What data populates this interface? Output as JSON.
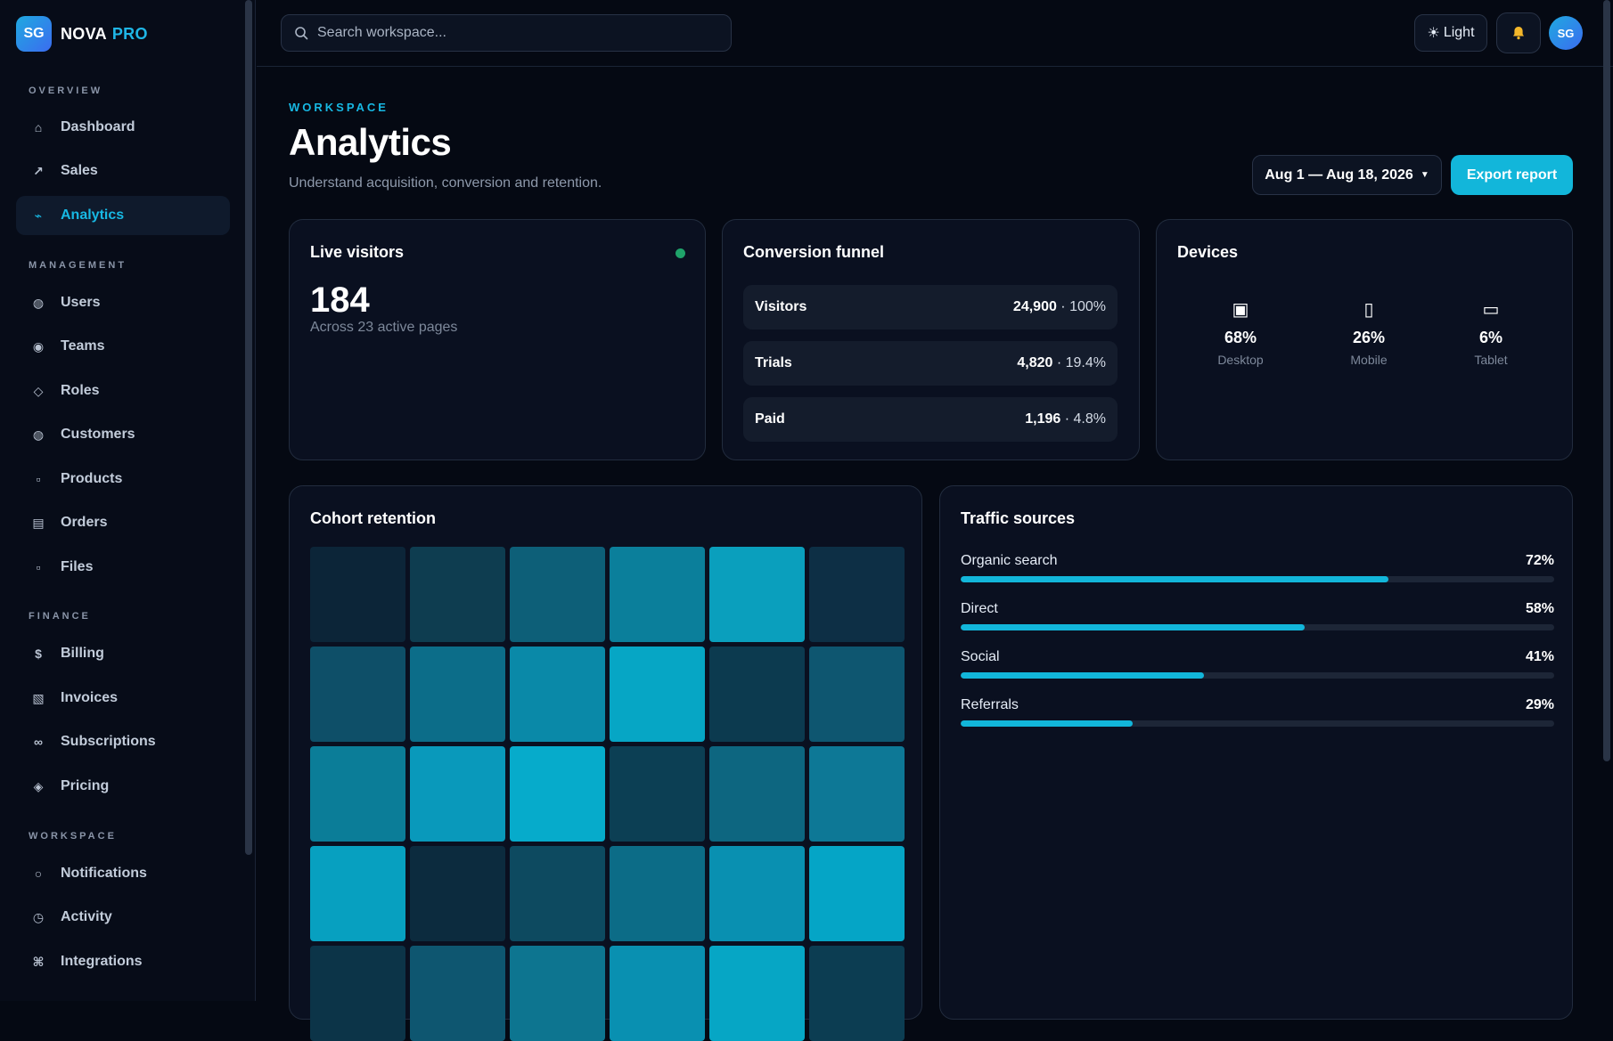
{
  "app": {
    "logo_initials": "SG",
    "name": "NOVA",
    "suffix": "PRO"
  },
  "sidebar": {
    "sections": [
      {
        "label": "OVERVIEW",
        "items": [
          {
            "label": "Dashboard",
            "icon": "home-icon",
            "glyph": "⌂"
          },
          {
            "label": "Sales",
            "icon": "trend-up-icon",
            "glyph": "↗"
          },
          {
            "label": "Analytics",
            "icon": "activity-icon",
            "glyph": "⌁",
            "active": true
          }
        ]
      },
      {
        "label": "MANAGEMENT",
        "items": [
          {
            "label": "Users",
            "icon": "users-icon",
            "glyph": "◍"
          },
          {
            "label": "Teams",
            "icon": "teams-icon",
            "glyph": "◉"
          },
          {
            "label": "Roles",
            "icon": "roles-icon",
            "glyph": "◇"
          },
          {
            "label": "Customers",
            "icon": "customers-icon",
            "glyph": "◍"
          },
          {
            "label": "Products",
            "icon": "products-icon",
            "glyph": "▫"
          },
          {
            "label": "Orders",
            "icon": "orders-icon",
            "glyph": "▤"
          },
          {
            "label": "Files",
            "icon": "files-icon",
            "glyph": "▫"
          }
        ]
      },
      {
        "label": "FINANCE",
        "items": [
          {
            "label": "Billing",
            "icon": "dollar-icon",
            "glyph": "$"
          },
          {
            "label": "Invoices",
            "icon": "invoice-icon",
            "glyph": "▧"
          },
          {
            "label": "Subscriptions",
            "icon": "infinity-icon",
            "glyph": "∞"
          },
          {
            "label": "Pricing",
            "icon": "tag-icon",
            "glyph": "◈"
          }
        ]
      },
      {
        "label": "WORKSPACE",
        "items": [
          {
            "label": "Notifications",
            "icon": "bell-icon",
            "glyph": "○"
          },
          {
            "label": "Activity",
            "icon": "clock-icon",
            "glyph": "◷"
          },
          {
            "label": "Integrations",
            "icon": "command-icon",
            "glyph": "⌘"
          }
        ]
      }
    ]
  },
  "topbar": {
    "search_placeholder": "Search workspace...",
    "theme_label": "Light",
    "theme_glyph": "☀",
    "avatar_initials": "SG"
  },
  "header": {
    "eyebrow": "WORKSPACE",
    "title": "Analytics",
    "subtitle": "Understand acquisition, conversion and retention.",
    "date_range": "Aug 1 — Aug 18, 2026",
    "export_label": "Export report"
  },
  "live": {
    "title": "Live visitors",
    "value": "184",
    "sub": "Across 23 active pages",
    "status_color": "#1fa36a"
  },
  "funnel": {
    "title": "Conversion funnel",
    "rows": [
      {
        "label": "Visitors",
        "count": "24,900",
        "pct": "100%"
      },
      {
        "label": "Trials",
        "count": "4,820",
        "pct": "19.4%"
      },
      {
        "label": "Paid",
        "count": "1,196",
        "pct": "4.8%"
      }
    ]
  },
  "devices": {
    "title": "Devices",
    "items": [
      {
        "label": "Desktop",
        "pct": "68%",
        "icon": "desktop-icon",
        "glyph": "▣"
      },
      {
        "label": "Mobile",
        "pct": "26%",
        "icon": "mobile-icon",
        "glyph": "▯"
      },
      {
        "label": "Tablet",
        "pct": "6%",
        "icon": "tablet-icon",
        "glyph": "▭"
      }
    ]
  },
  "cohort": {
    "title": "Cohort retention",
    "cells": [
      [
        "#0c2538",
        "#0e3d50",
        "#0d5f78",
        "#0b7f9b",
        "#0a9fbd",
        "#0d2f45"
      ],
      [
        "#0e4f68",
        "#0c6d89",
        "#0a89a8",
        "#06a6c5",
        "#0c3a4f",
        "#0e5670"
      ],
      [
        "#0b7d98",
        "#0999bb",
        "#06abcb",
        "#0c3f54",
        "#0d6680",
        "#0d7896"
      ],
      [
        "#07a0c0",
        "#0c2b3e",
        "#0d4a60",
        "#0c6c87",
        "#0990b1",
        "#05a5c6"
      ],
      [
        "#0c3448",
        "#0e5670",
        "#0d7590",
        "#0990b1",
        "#06a6c5",
        "#0c3d52"
      ]
    ]
  },
  "traffic": {
    "title": "Traffic sources",
    "rows": [
      {
        "label": "Organic search",
        "pct_label": "72%",
        "value": 0.72
      },
      {
        "label": "Direct",
        "pct_label": "58%",
        "value": 0.58
      },
      {
        "label": "Social",
        "pct_label": "41%",
        "value": 0.41
      },
      {
        "label": "Referrals",
        "pct_label": "29%",
        "value": 0.29
      }
    ]
  },
  "colors": {
    "accent": "#12b6da",
    "bell": "#f4b72a"
  }
}
